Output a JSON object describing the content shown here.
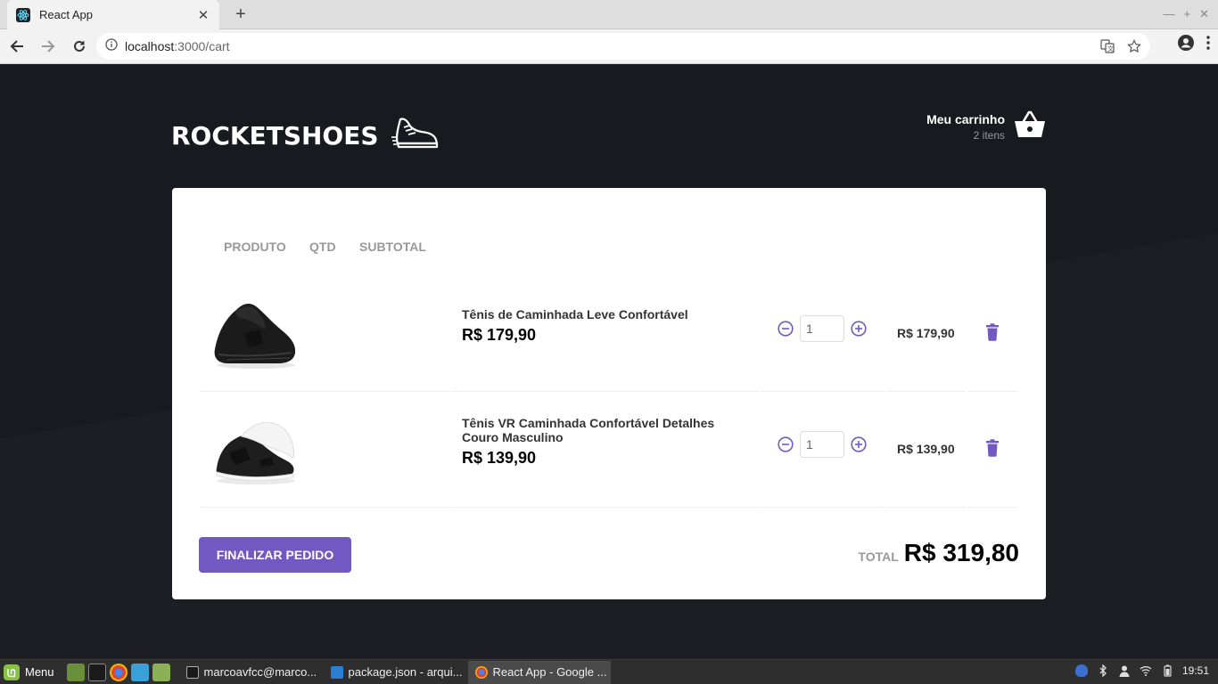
{
  "browser": {
    "tab_title": "React App",
    "url_host": "localhost",
    "url_path": ":3000/cart"
  },
  "header": {
    "brand": "ROCKETSHOES",
    "cart_label": "Meu carrinho",
    "cart_count": "2 itens"
  },
  "table": {
    "col_product": "PRODUTO",
    "col_qty": "QTD",
    "col_subtotal": "SUBTOTAL"
  },
  "items": [
    {
      "name": "Tênis de Caminhada Leve Confortável",
      "price": "R$ 179,90",
      "qty": "1",
      "subtotal": "R$ 179,90"
    },
    {
      "name": "Tênis VR Caminhada Confortável Detalhes Couro Masculino",
      "price": "R$ 139,90",
      "qty": "1",
      "subtotal": "R$ 139,90"
    }
  ],
  "footer": {
    "checkout_label": "Finalizar pedido",
    "total_label": "TOTAL",
    "total_value": "R$ 319,80"
  },
  "taskbar": {
    "menu_label": "Menu",
    "tasks": [
      "marcoavfcc@marco...",
      "package.json - arqui...",
      "React App - Google ..."
    ],
    "clock": "19:51"
  },
  "colors": {
    "accent": "#7159c1",
    "background": "#191920"
  }
}
